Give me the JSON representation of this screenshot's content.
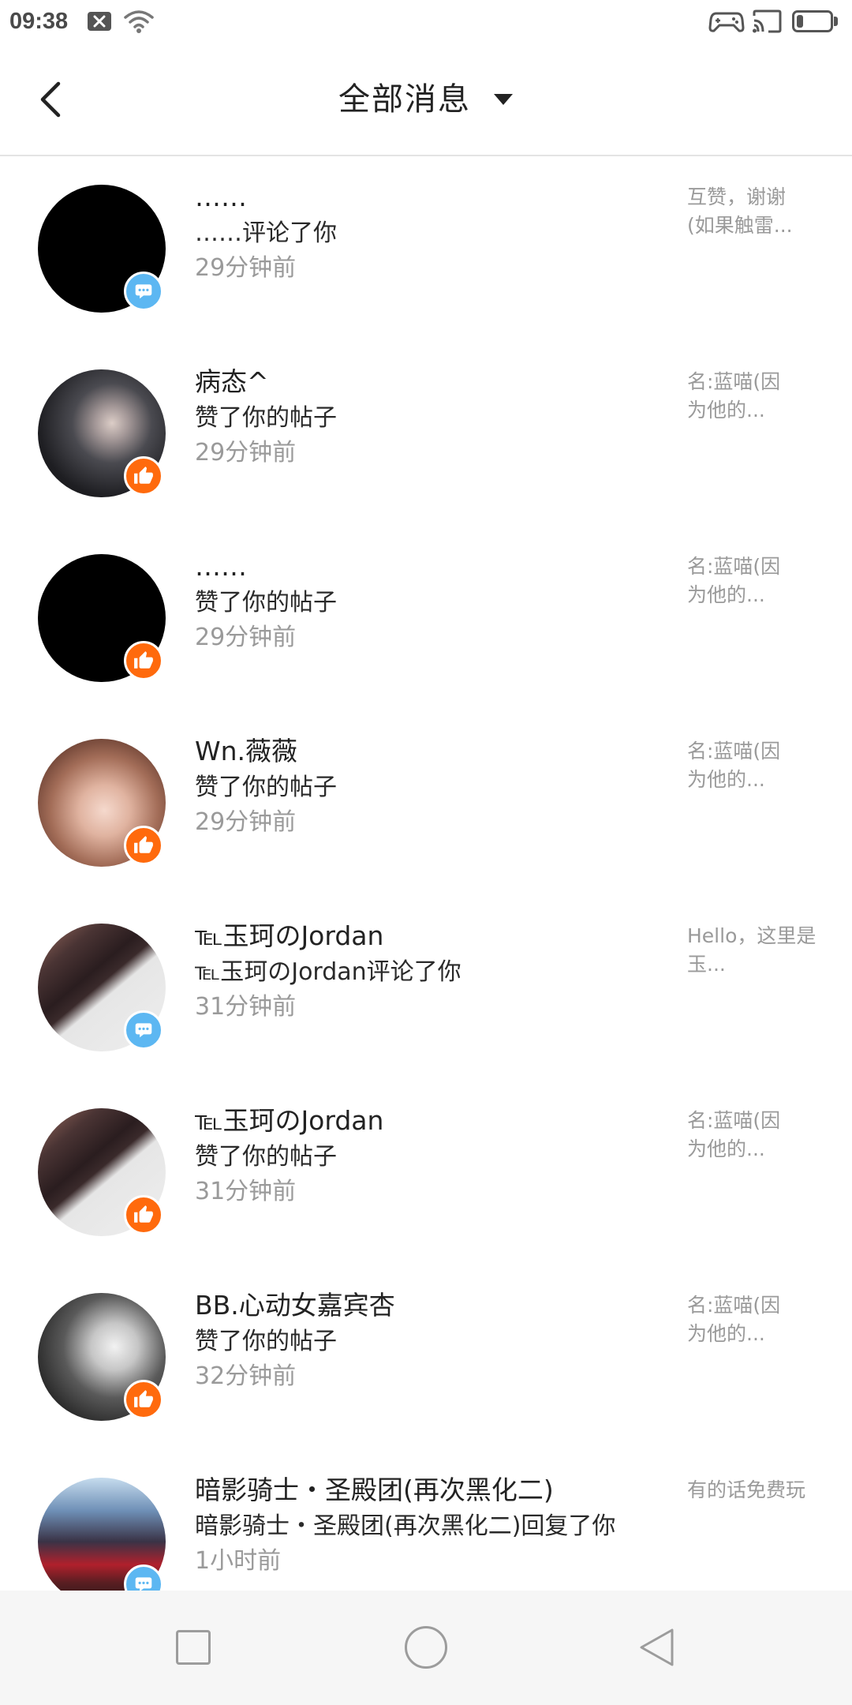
{
  "status_bar": {
    "time": "09:38",
    "left_icons": [
      "notification-close-icon",
      "wifi-icon"
    ],
    "right_icons": [
      "gamepad-icon",
      "cast-icon",
      "battery-icon"
    ],
    "battery_fraction": 0.2
  },
  "header": {
    "title": "全部消息",
    "back_icon": "back-chevron-icon",
    "dropdown_icon": "dropdown-triangle-icon"
  },
  "badge_colors": {
    "comment-icon": "#5CB7F2",
    "thumbs-up-icon": "#FF6A0D"
  },
  "messages": [
    {
      "name": "……",
      "action": "……评论了你",
      "time": "29分钟前",
      "snippet": [
        "互赞，谢谢",
        "(如果触雷..."
      ],
      "badge_icon": "comment-icon"
    },
    {
      "name": "病态^",
      "action": "赞了你的帖子",
      "time": "29分钟前",
      "snippet": [
        "名:蓝喵(因",
        "为他的..."
      ],
      "badge_icon": "thumbs-up-icon"
    },
    {
      "name": "……",
      "action": "赞了你的帖子",
      "time": "29分钟前",
      "snippet": [
        "名:蓝喵(因",
        "为他的..."
      ],
      "badge_icon": "thumbs-up-icon"
    },
    {
      "name": "Wn.薇薇",
      "action": "赞了你的帖子",
      "time": "29分钟前",
      "snippet": [
        "名:蓝喵(因",
        "为他的..."
      ],
      "badge_icon": "thumbs-up-icon"
    },
    {
      "name": "℡玉珂のJordan",
      "action": "℡玉珂のJordan评论了你",
      "time": "31分钟前",
      "snippet": [
        "Hello，这里是",
        "玉..."
      ],
      "badge_icon": "comment-icon"
    },
    {
      "name": "℡玉珂のJordan",
      "action": "赞了你的帖子",
      "time": "31分钟前",
      "snippet": [
        "名:蓝喵(因",
        "为他的..."
      ],
      "badge_icon": "thumbs-up-icon"
    },
    {
      "name": "BB.心动女嘉宾杏",
      "action": "赞了你的帖子",
      "time": "32分钟前",
      "snippet": [
        "名:蓝喵(因",
        "为他的..."
      ],
      "badge_icon": "thumbs-up-icon"
    },
    {
      "name": "暗影骑士・圣殿团(再次黑化二)",
      "action": "暗影骑士・圣殿团(再次黑化二)回复了你",
      "time": "1小时前",
      "snippet": [
        "有的话免费玩"
      ],
      "badge_icon": "comment-icon"
    }
  ],
  "nav_bar": {
    "icons": [
      "recent-apps-icon",
      "home-icon",
      "back-icon"
    ]
  }
}
